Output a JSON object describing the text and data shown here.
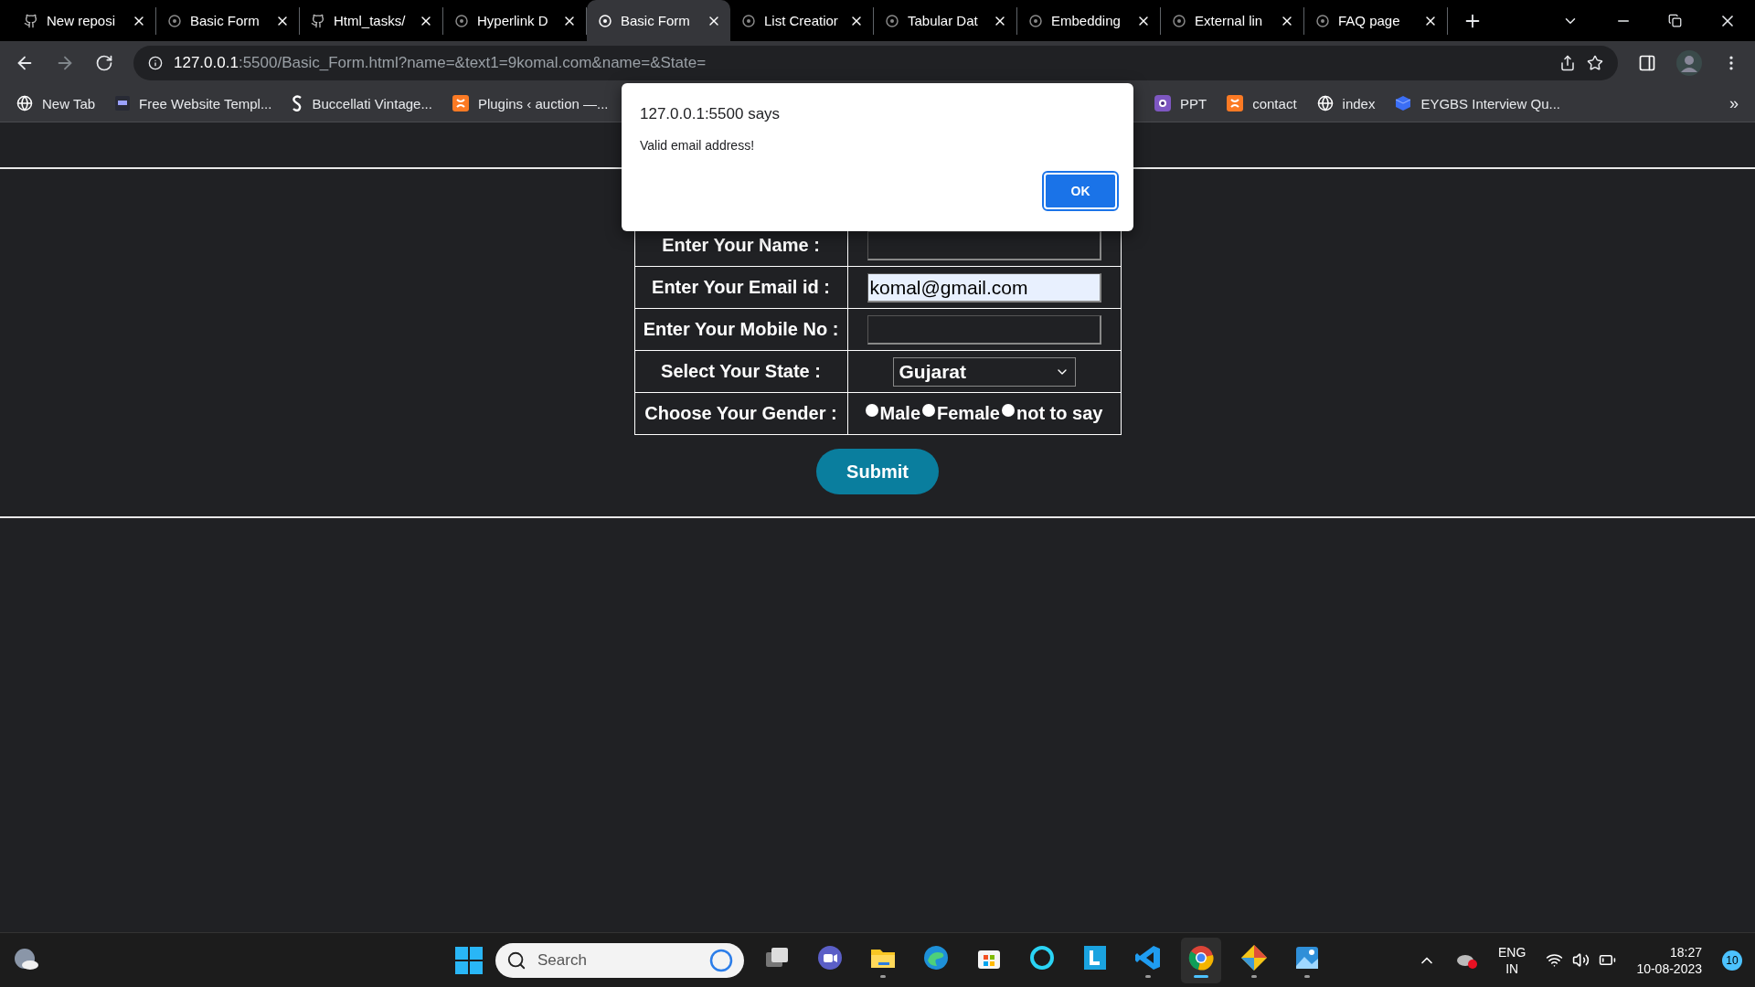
{
  "tabs": [
    {
      "kind": "github",
      "label": "New reposi",
      "selected": false
    },
    {
      "kind": "page",
      "label": "Basic Form",
      "selected": false
    },
    {
      "kind": "github",
      "label": "Html_tasks/",
      "selected": false
    },
    {
      "kind": "page",
      "label": "Hyperlink D",
      "selected": false
    },
    {
      "kind": "page",
      "label": "Basic Form",
      "selected": true
    },
    {
      "kind": "page",
      "label": "List Creatior",
      "selected": false
    },
    {
      "kind": "page",
      "label": "Tabular Dat",
      "selected": false
    },
    {
      "kind": "page",
      "label": "Embedding",
      "selected": false
    },
    {
      "kind": "page",
      "label": "External lin",
      "selected": false
    },
    {
      "kind": "page",
      "label": "FAQ page",
      "selected": false
    }
  ],
  "address": {
    "host": "127.0.0.1",
    "rest": ":5500/Basic_Form.html?name=&text1=9komal.com&name=&State="
  },
  "bookmarks_left": [
    {
      "kind": "globe",
      "label": "New Tab"
    },
    {
      "kind": "w3",
      "label": "Free Website Templ..."
    },
    {
      "kind": "serif",
      "label": "Buccellati Vintage..."
    },
    {
      "kind": "xampp",
      "label": "Plugins ‹ auction —..."
    }
  ],
  "bookmarks_right": [
    {
      "kind": "ppt",
      "label": "PPT"
    },
    {
      "kind": "xampp",
      "label": "contact"
    },
    {
      "kind": "globe",
      "label": "index"
    },
    {
      "kind": "cube",
      "label": "EYGBS Interview Qu..."
    }
  ],
  "bookmarks_more": "»",
  "form": {
    "rows": [
      {
        "kind": "text",
        "label": "Enter Your Name :",
        "value": ""
      },
      {
        "kind": "email",
        "label": "Enter Your Email id :",
        "value": "komal@gmail.com"
      },
      {
        "kind": "text",
        "label": "Enter Your Mobile No :",
        "value": ""
      },
      {
        "kind": "select",
        "label": "Select Your State :",
        "value": "Gujarat"
      },
      {
        "kind": "radio",
        "label": "Choose Your Gender :",
        "options": [
          {
            "label": "Male",
            "checked": false
          },
          {
            "label": "Female",
            "checked": false
          },
          {
            "label": "not to say",
            "checked": false
          }
        ]
      }
    ],
    "submit": "Submit"
  },
  "dialog": {
    "title": "127.0.0.1:5500 says",
    "message": "Valid email address!",
    "button": "OK"
  },
  "taskbar": {
    "search_placeholder": "Search",
    "apps": [
      {
        "kind": "taskview",
        "running": false,
        "active": false
      },
      {
        "kind": "teams",
        "running": false,
        "active": false
      },
      {
        "kind": "explorer",
        "running": true,
        "active": false
      },
      {
        "kind": "edge",
        "running": false,
        "active": false
      },
      {
        "kind": "store",
        "running": false,
        "active": false
      },
      {
        "kind": "ring",
        "running": false,
        "active": false
      },
      {
        "kind": "l",
        "running": false,
        "active": false
      },
      {
        "kind": "vscode",
        "running": true,
        "active": false
      },
      {
        "kind": "chrome",
        "running": true,
        "active": true
      },
      {
        "kind": "git",
        "running": true,
        "active": false
      },
      {
        "kind": "photos",
        "running": true,
        "active": false
      }
    ],
    "language": "ENG",
    "region": "IN",
    "time": "18:27",
    "date": "10-08-2023",
    "notifications": "10"
  }
}
